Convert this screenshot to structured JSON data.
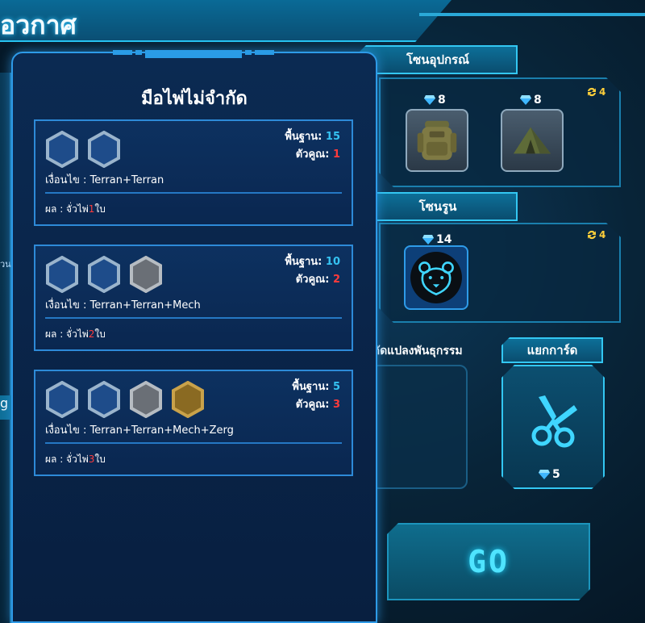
{
  "header": {
    "title": "อวกาศ"
  },
  "zones": {
    "equipment": {
      "label": "โซนอุปกรณ์",
      "refresh_count": "4",
      "items": [
        {
          "name": "backpack",
          "price": "8"
        },
        {
          "name": "tent",
          "price": "8"
        }
      ]
    },
    "rune": {
      "label": "โซนรูน",
      "refresh_count": "4",
      "items": [
        {
          "name": "bear-rune",
          "price": "14"
        }
      ]
    },
    "gene": {
      "label": "ดัดแปลงพันธุกรรม"
    },
    "split_card": {
      "label": "แยกการ์ด",
      "price": "5"
    }
  },
  "go_button": {
    "label": "GO"
  },
  "side_label": "g",
  "side_small": "วน",
  "modal": {
    "title": "มือไพ่ไม่จำกัด",
    "cards": [
      {
        "hexes": [
          "blue",
          "blue"
        ],
        "base_label": "พื้นฐาน:",
        "base_value": "15",
        "mult_label": "ตัวคูณ:",
        "mult_value": "1",
        "bond_label": "เงื่อนไข :",
        "bond_value": "Terran+Terran",
        "result_prefix": "ผล : จั่วไพ่",
        "result_num": "1",
        "result_suffix": "ใบ"
      },
      {
        "hexes": [
          "blue",
          "blue",
          "gray"
        ],
        "base_label": "พื้นฐาน:",
        "base_value": "10",
        "mult_label": "ตัวคูณ:",
        "mult_value": "2",
        "bond_label": "เงื่อนไข :",
        "bond_value": "Terran+Terran+Mech",
        "result_prefix": "ผล : จั่วไพ่",
        "result_num": "2",
        "result_suffix": "ใบ"
      },
      {
        "hexes": [
          "blue",
          "blue",
          "gray",
          "gold"
        ],
        "base_label": "พื้นฐาน:",
        "base_value": "5",
        "mult_label": "ตัวคูณ:",
        "mult_value": "3",
        "bond_label": "เงื่อนไข :",
        "bond_value": "Terran+Terran+Mech+Zerg",
        "result_prefix": "ผล : จั่วไพ่",
        "result_num": "3",
        "result_suffix": "ใบ"
      }
    ]
  },
  "colors": {
    "accent": "#2e9be8",
    "base_value": "#35c3f2",
    "multiplier": "#ff3b3b",
    "refresh": "#ffcf3a",
    "go_text": "#4fe4ff"
  }
}
